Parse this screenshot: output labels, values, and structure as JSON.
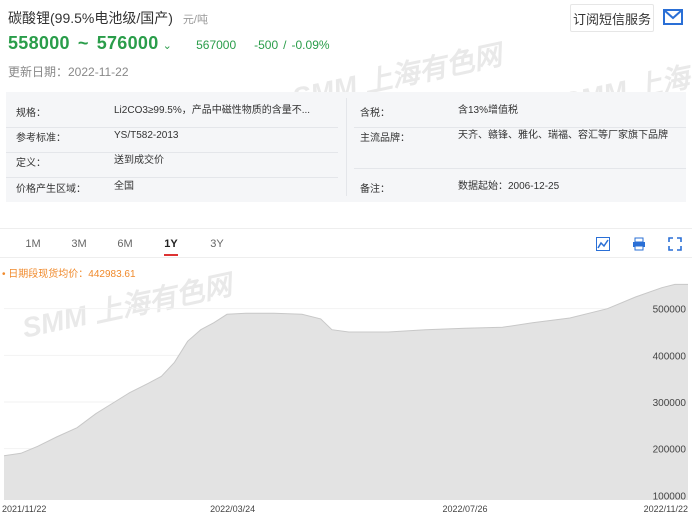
{
  "header": {
    "title": "碳酸锂(99.5%电池级/国产)",
    "unit": "元/吨",
    "subscribe_label": "订阅短信服务",
    "mail_icon": "mail-icon"
  },
  "price": {
    "low": "558000",
    "tilde": "~",
    "high": "576000",
    "trend_glyph": "⌄",
    "average": "567000",
    "change": "-500",
    "separator": "/",
    "change_pct": "-0.09%",
    "updated": "更新日期：2022-11-22"
  },
  "colors": {
    "up_down_green": "#2a9d4a",
    "legend_orange": "#f08a2c",
    "active_tab_red": "#dd3333",
    "area_fill": "#e3e3e3",
    "line": "#c8c8c8"
  },
  "info": {
    "left": [
      {
        "key": "规格：",
        "value": "Li2CO3≥99.5%，产品中磁性物质的含量不..."
      },
      {
        "key": "参考标准：",
        "value": "YS/T582-2013"
      },
      {
        "key": "定义：",
        "value": "送到成交价"
      },
      {
        "key": "价格产生区域：",
        "value": "全国"
      }
    ],
    "right": [
      {
        "key": "含税：",
        "value": "含13%增值税"
      },
      {
        "key": "主流品牌：",
        "value": "天齐、赣锋、雅化、瑞福、容汇等厂家旗下品牌"
      },
      {
        "key": "备注：",
        "value": "数据起始：2006-12-25"
      }
    ]
  },
  "range_tabs": [
    "1M",
    "3M",
    "6M",
    "1Y",
    "3Y"
  ],
  "active_tab": "1Y",
  "tools": [
    "table-icon",
    "print-icon",
    "fullscreen-icon"
  ],
  "legend": "• 日期段现货均价：442983.61",
  "watermarks": [
    "SMM 上海有色网",
    "SMM 上海有色网",
    "SMM 上海有色网"
  ],
  "chart_data": {
    "type": "area",
    "title": "",
    "xlabel": "",
    "ylabel": "",
    "ylim": [
      90000,
      600000
    ],
    "y_ticks": [
      100000,
      200000,
      300000,
      400000,
      500000
    ],
    "x_ticks": [
      "2021/11/22",
      "2022/03/24",
      "2022/07/26",
      "2022/11/22"
    ],
    "x_start": "2021-11-22",
    "x_end": "2022-11-22",
    "series": [
      {
        "points": [
          [
            "2021-11-22",
            185000
          ],
          [
            "2021-12-01",
            190000
          ],
          [
            "2021-12-10",
            205000
          ],
          [
            "2021-12-20",
            225000
          ],
          [
            "2021-12-31",
            245000
          ],
          [
            "2022-01-10",
            275000
          ],
          [
            "2022-01-20",
            300000
          ],
          [
            "2022-01-28",
            320000
          ],
          [
            "2022-02-07",
            340000
          ],
          [
            "2022-02-14",
            355000
          ],
          [
            "2022-02-21",
            385000
          ],
          [
            "2022-02-28",
            430000
          ],
          [
            "2022-03-07",
            455000
          ],
          [
            "2022-03-14",
            470000
          ],
          [
            "2022-03-21",
            488000
          ],
          [
            "2022-03-31",
            490000
          ],
          [
            "2022-04-15",
            490000
          ],
          [
            "2022-04-30",
            488000
          ],
          [
            "2022-05-10",
            478000
          ],
          [
            "2022-05-16",
            455000
          ],
          [
            "2022-05-25",
            450000
          ],
          [
            "2022-06-15",
            450000
          ],
          [
            "2022-07-05",
            455000
          ],
          [
            "2022-07-26",
            458000
          ],
          [
            "2022-08-15",
            460000
          ],
          [
            "2022-08-31",
            470000
          ],
          [
            "2022-09-20",
            480000
          ],
          [
            "2022-10-10",
            500000
          ],
          [
            "2022-10-25",
            525000
          ],
          [
            "2022-11-08",
            545000
          ],
          [
            "2022-11-15",
            552000
          ],
          [
            "2022-11-22",
            552000
          ]
        ]
      }
    ]
  }
}
